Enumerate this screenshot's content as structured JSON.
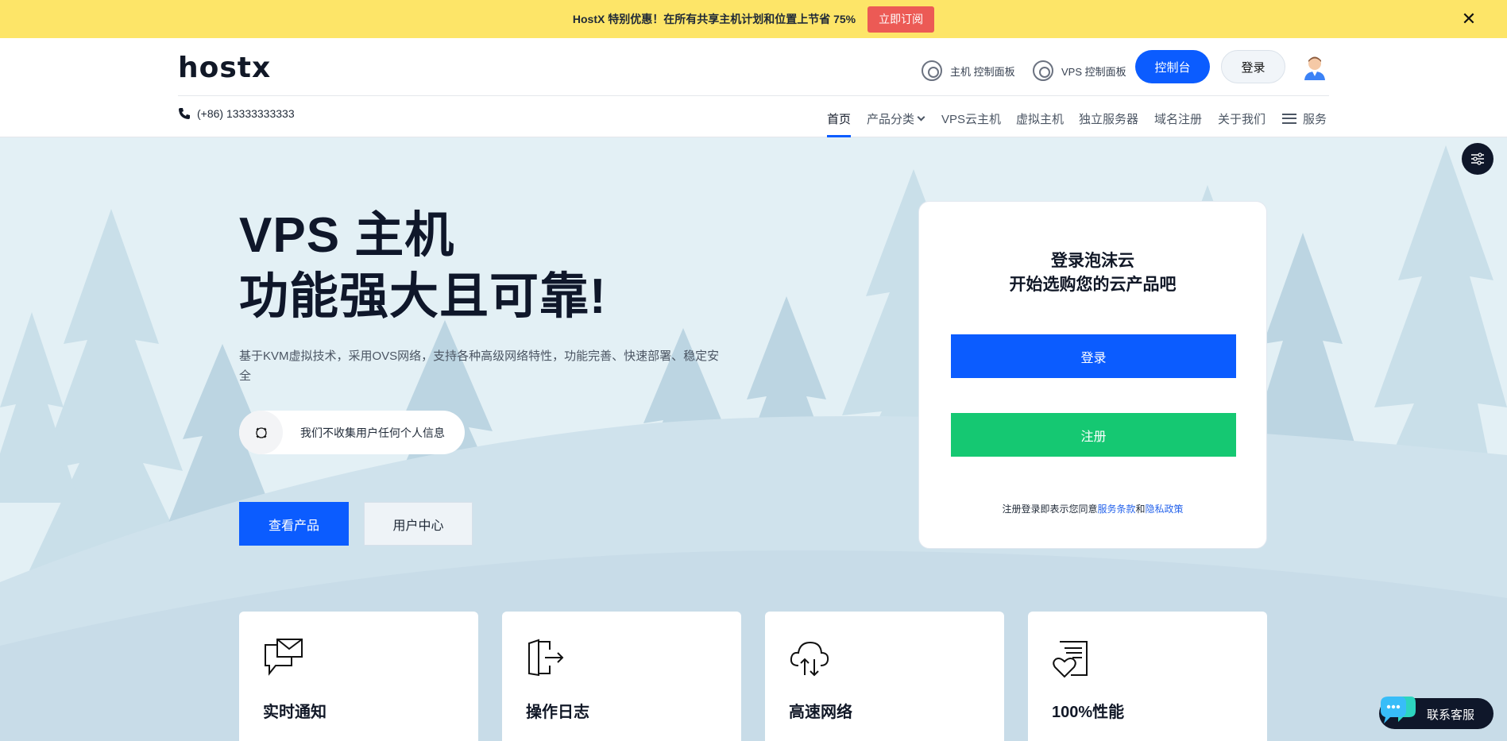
{
  "promo": {
    "text": "HostX 特别优惠！在所有共享主机计划和位置上节省 75%",
    "button": "立即订阅",
    "close_icon": "close-icon"
  },
  "header": {
    "logo": "hostx",
    "host_panel": "主机 控制面板",
    "vps_panel": "VPS 控制面板",
    "console_button": "控制台",
    "login_button": "登录",
    "phone": "(+86) 13333333333",
    "nav": {
      "home": "首页",
      "products": "产品分类",
      "vps": "VPS云主机",
      "virtual": "虚拟主机",
      "dedicated": "独立服务器",
      "domain": "域名注册",
      "about": "关于我们",
      "services": "服务"
    }
  },
  "hero": {
    "title_line1": "VPS 主机",
    "title_line2": "功能强大且可靠!",
    "description": "基于KVM虚拟技术，采用OVS网络，支持各种高级网络特性，功能完善、快速部署、稳定安全",
    "privacy_text": "我们不收集用户任何个人信息",
    "products_button": "查看产品",
    "user_center_button": "用户中心"
  },
  "login_card": {
    "title_line1": "登录泡沫云",
    "title_line2": "开始选购您的云产品吧",
    "login_button": "登录",
    "register_button": "注册",
    "terms_prefix": "注册登录即表示您同意",
    "terms_link": "服务条款",
    "terms_and": "和",
    "privacy_link": "隐私政策"
  },
  "features": [
    {
      "title": "实时通知",
      "icon": "message-envelope-icon"
    },
    {
      "title": "操作日志",
      "icon": "exit-door-icon"
    },
    {
      "title": "高速网络",
      "icon": "cloud-transfer-icon"
    },
    {
      "title": "100%性能",
      "icon": "heart-document-icon"
    }
  ],
  "chat": {
    "label": "联系客服"
  },
  "colors": {
    "promo_bg": "#fde568",
    "primary": "#0b5cff",
    "success": "#15c872",
    "danger": "#ec5a55",
    "hero_bg": "#e3f0f5"
  }
}
